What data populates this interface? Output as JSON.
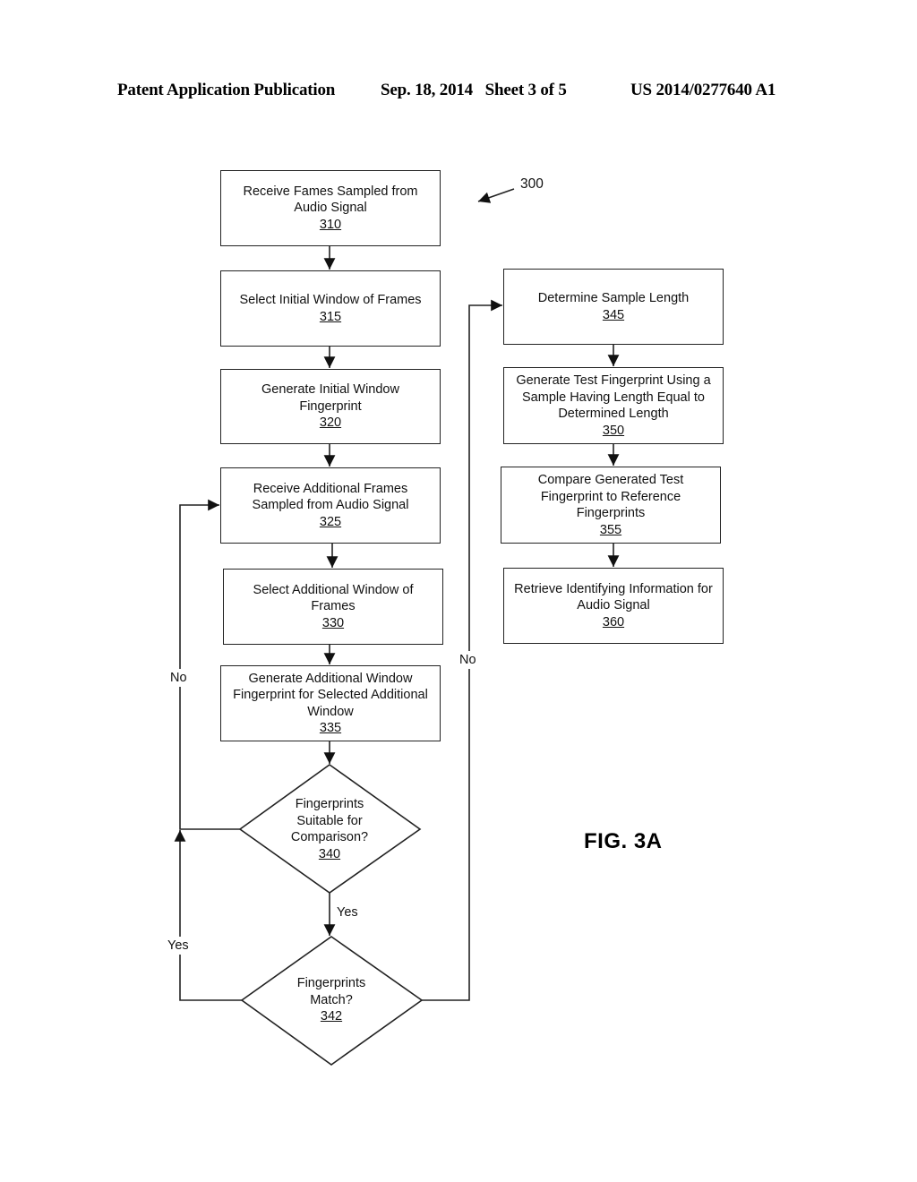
{
  "header": {
    "left": "Patent Application Publication",
    "date_sheet": "Sep. 18, 2014   Sheet 3 of 5",
    "pub_number": "US 2014/0277640 A1"
  },
  "figure": {
    "label": "FIG. 3A",
    "ref_number": "300"
  },
  "steps": {
    "s310": {
      "text": "Receive Fames Sampled from Audio Signal",
      "lines": [
        "Receive Fames Sampled from",
        "Audio Signal"
      ],
      "ref": "310"
    },
    "s315": {
      "text": "Select Initial Window of Frames",
      "lines": [
        "Select Initial Window of Frames"
      ],
      "ref": "315"
    },
    "s320": {
      "text": "Generate Initial Window Fingerprint",
      "lines": [
        "Generate Initial Window",
        "Fingerprint"
      ],
      "ref": "320"
    },
    "s325": {
      "text": "Receive Additional Frames Sampled from Audio Signal",
      "lines": [
        "Receive Additional Frames",
        "Sampled from Audio Signal"
      ],
      "ref": "325"
    },
    "s330": {
      "text": "Select Additional Window of Frames",
      "lines": [
        "Select Additional Window of",
        "Frames"
      ],
      "ref": "330"
    },
    "s335": {
      "text": "Generate Additional Window Fingerprint for Selected Additional Window",
      "lines": [
        "Generate Additional Window",
        "Fingerprint for Selected Additional",
        "Window"
      ],
      "ref": "335"
    },
    "s340": {
      "text": "Fingerprints Suitable for Comparison?",
      "lines": [
        "Fingerprints",
        "Suitable for",
        "Comparison?"
      ],
      "ref": "340"
    },
    "s342": {
      "text": "Fingerprints Match?",
      "lines": [
        "Fingerprints",
        "Match?"
      ],
      "ref": "342"
    },
    "s345": {
      "text": "Determine Sample Length",
      "lines": [
        "Determine Sample Length"
      ],
      "ref": "345"
    },
    "s350": {
      "text": "Generate Test Fingerprint Using a Sample Having Length Equal to Determined Length",
      "lines": [
        "Generate Test Fingerprint Using a",
        "Sample Having Length Equal to",
        "Determined Length"
      ],
      "ref": "350"
    },
    "s355": {
      "text": "Compare Generated Test Fingerprint to Reference Fingerprints",
      "lines": [
        "Compare Generated Test",
        "Fingerprint to Reference",
        "Fingerprints"
      ],
      "ref": "355"
    },
    "s360": {
      "text": "Retrieve Identifying Information for Audio Signal",
      "lines": [
        "Retrieve Identifying Information for",
        "Audio Signal"
      ],
      "ref": "360"
    }
  },
  "edge_labels": {
    "no_340": "No",
    "yes_340": "Yes",
    "yes_342": "Yes",
    "no_342": "No"
  }
}
